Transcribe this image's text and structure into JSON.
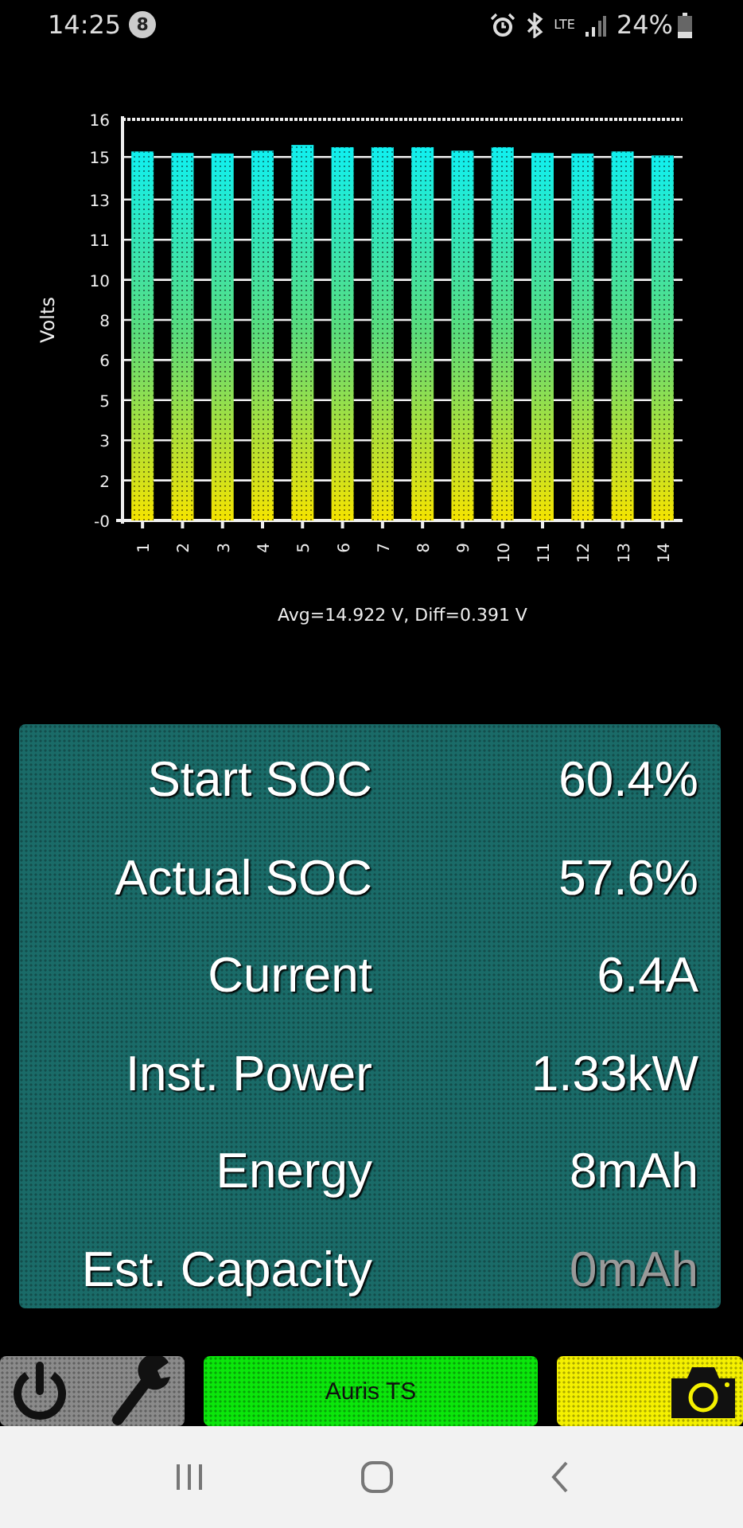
{
  "status_bar": {
    "time": "14:25",
    "notification_count": "8",
    "network": "LTE",
    "battery": "24%"
  },
  "chart": {
    "chart_data": {
      "type": "bar",
      "ylabel": "Volts",
      "xlabel": "Avg=14.922 V, Diff=0.391 V",
      "categories": [
        "1",
        "2",
        "3",
        "4",
        "5",
        "6",
        "7",
        "8",
        "9",
        "10",
        "11",
        "12",
        "13",
        "14"
      ],
      "values": [
        14.72,
        14.66,
        14.64,
        14.75,
        14.98,
        14.89,
        14.89,
        14.89,
        14.75,
        14.89,
        14.66,
        14.64,
        14.72,
        14.56
      ],
      "ylim": [
        0,
        16
      ],
      "yticks": [
        {
          "value": 0,
          "label": "-0"
        },
        {
          "value": 1.6,
          "label": "2"
        },
        {
          "value": 3.2,
          "label": "3"
        },
        {
          "value": 4.8,
          "label": "5"
        },
        {
          "value": 6.4,
          "label": "6"
        },
        {
          "value": 8,
          "label": "8"
        },
        {
          "value": 9.6,
          "label": "10"
        },
        {
          "value": 11.2,
          "label": "11"
        },
        {
          "value": 12.8,
          "label": "13"
        },
        {
          "value": 14.5,
          "label": "15"
        },
        {
          "value": 16,
          "label": "16"
        }
      ],
      "grid": true
    }
  },
  "stats": [
    {
      "label": "Start SOC",
      "value": "60.4%",
      "dimmed": false
    },
    {
      "label": "Actual SOC",
      "value": "57.6%",
      "dimmed": false
    },
    {
      "label": "Current",
      "value": "6.4A",
      "dimmed": false
    },
    {
      "label": "Inst. Power",
      "value": "1.33kW",
      "dimmed": false
    },
    {
      "label": "Energy",
      "value": "8mAh",
      "dimmed": false
    },
    {
      "label": "Est. Capacity",
      "value": "0mAh",
      "dimmed": true
    }
  ],
  "action_bar": {
    "device_label": "Auris TS"
  }
}
